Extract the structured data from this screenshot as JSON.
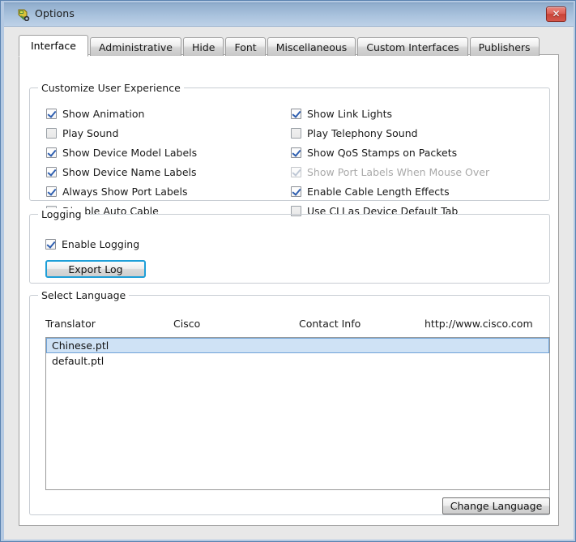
{
  "window": {
    "title": "Options",
    "icon": "packet-tracer-icon",
    "close_label": "✕"
  },
  "tabs": [
    {
      "label": "Interface",
      "selected": true
    },
    {
      "label": "Administrative",
      "selected": false
    },
    {
      "label": "Hide",
      "selected": false
    },
    {
      "label": "Font",
      "selected": false
    },
    {
      "label": "Miscellaneous",
      "selected": false
    },
    {
      "label": "Custom Interfaces",
      "selected": false
    },
    {
      "label": "Publishers",
      "selected": false
    }
  ],
  "customize_group": {
    "legend": "Customize User Experience",
    "left_column": [
      {
        "label": "Show Animation",
        "checked": true,
        "disabled": false
      },
      {
        "label": "Play Sound",
        "checked": false,
        "disabled": false
      },
      {
        "label": "Show Device Model Labels",
        "checked": true,
        "disabled": false
      },
      {
        "label": "Show Device Name Labels",
        "checked": true,
        "disabled": false
      },
      {
        "label": "Always Show Port Labels",
        "checked": true,
        "disabled": false
      },
      {
        "label": "Disable Auto Cable",
        "checked": false,
        "disabled": false
      }
    ],
    "right_column": [
      {
        "label": "Show Link Lights",
        "checked": true,
        "disabled": false
      },
      {
        "label": "Play Telephony Sound",
        "checked": false,
        "disabled": false
      },
      {
        "label": "Show QoS Stamps on Packets",
        "checked": true,
        "disabled": false
      },
      {
        "label": "Show Port Labels When Mouse Over",
        "checked": true,
        "disabled": true
      },
      {
        "label": "Enable Cable Length Effects",
        "checked": true,
        "disabled": false
      },
      {
        "label": "Use CLI as Device Default Tab",
        "checked": false,
        "disabled": false
      }
    ]
  },
  "logging_group": {
    "legend": "Logging",
    "enable_logging": {
      "label": "Enable Logging",
      "checked": true
    },
    "export_button": "Export Log"
  },
  "language_group": {
    "legend": "Select Language",
    "headers": [
      {
        "label": "Translator"
      },
      {
        "label": "Cisco"
      },
      {
        "label": "Contact Info"
      },
      {
        "label": "http://www.cisco.com"
      }
    ],
    "items": [
      {
        "label": "Chinese.ptl",
        "selected": true
      },
      {
        "label": "default.ptl",
        "selected": false
      }
    ],
    "change_button": "Change Language"
  },
  "colors": {
    "titlebar_top": "#7d9cc0",
    "titlebar_bottom": "#bdd1e7",
    "window_border": "#5b83b0",
    "panel_bg": "#e8e8e8",
    "check_blue": "#2f5fb0",
    "focus_blue": "#1e9fd8",
    "selection_bg": "#cfe2f5",
    "selection_border": "#6fa3d8",
    "close_red": "#c84337"
  }
}
